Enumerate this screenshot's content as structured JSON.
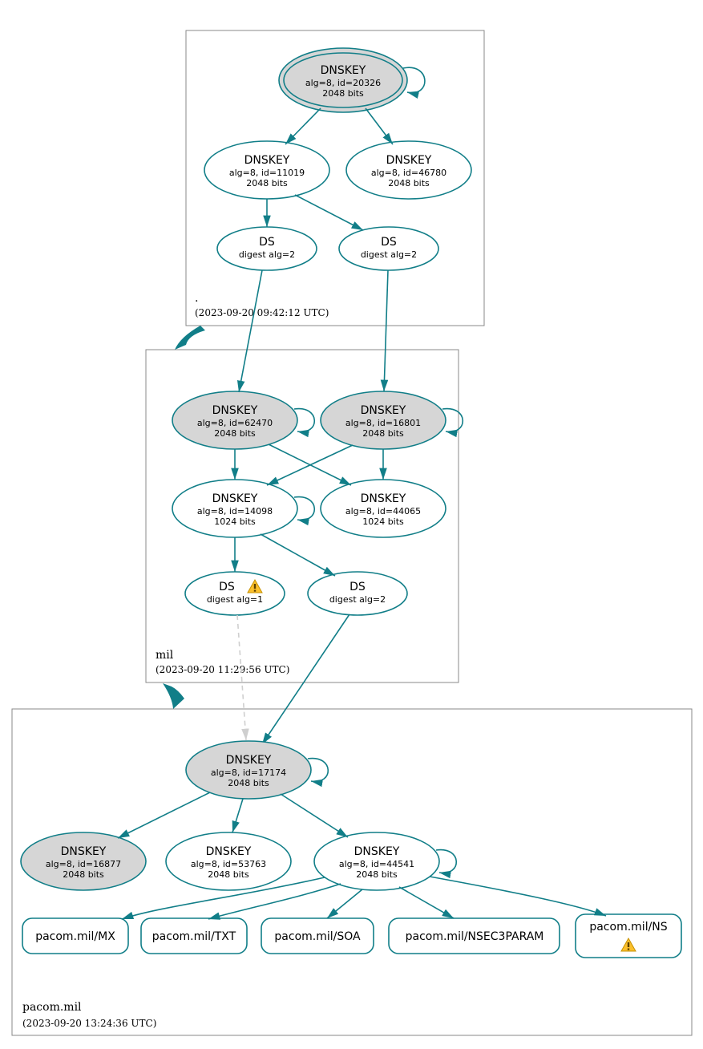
{
  "colors": {
    "teal": "#117e88",
    "grey_fill": "#d6d6d6",
    "warning_yellow": "#fbc02d",
    "warning_border": "#c79100",
    "warning_bang": "#5d4100"
  },
  "zones": {
    "root": {
      "title": ".",
      "timestamp": "(2023-09-20 09:42:12 UTC)"
    },
    "mil": {
      "title": "mil",
      "timestamp": "(2023-09-20 11:29:56 UTC)"
    },
    "pacom": {
      "title": "pacom.mil",
      "timestamp": "(2023-09-20 13:24:36 UTC)"
    }
  },
  "nodes": {
    "root_ksk": {
      "l1": "DNSKEY",
      "l2": "alg=8, id=20326",
      "l3": "2048 bits"
    },
    "root_zsk1": {
      "l1": "DNSKEY",
      "l2": "alg=8, id=11019",
      "l3": "2048 bits"
    },
    "root_zsk2": {
      "l1": "DNSKEY",
      "l2": "alg=8, id=46780",
      "l3": "2048 bits"
    },
    "root_ds1": {
      "l1": "DS",
      "l2": "digest alg=2"
    },
    "root_ds2": {
      "l1": "DS",
      "l2": "digest alg=2"
    },
    "mil_ksk1": {
      "l1": "DNSKEY",
      "l2": "alg=8, id=62470",
      "l3": "2048 bits"
    },
    "mil_ksk2": {
      "l1": "DNSKEY",
      "l2": "alg=8, id=16801",
      "l3": "2048 bits"
    },
    "mil_zsk1": {
      "l1": "DNSKEY",
      "l2": "alg=8, id=14098",
      "l3": "1024 bits"
    },
    "mil_zsk2": {
      "l1": "DNSKEY",
      "l2": "alg=8, id=44065",
      "l3": "1024 bits"
    },
    "mil_ds1": {
      "l1": "DS",
      "l2": "digest alg=1"
    },
    "mil_ds2": {
      "l1": "DS",
      "l2": "digest alg=2"
    },
    "pacom_ksk": {
      "l1": "DNSKEY",
      "l2": "alg=8, id=17174",
      "l3": "2048 bits"
    },
    "pacom_k1": {
      "l1": "DNSKEY",
      "l2": "alg=8, id=16877",
      "l3": "2048 bits"
    },
    "pacom_k2": {
      "l1": "DNSKEY",
      "l2": "alg=8, id=53763",
      "l3": "2048 bits"
    },
    "pacom_k3": {
      "l1": "DNSKEY",
      "l2": "alg=8, id=44541",
      "l3": "2048 bits"
    },
    "rr_mx": {
      "l1": "pacom.mil/MX"
    },
    "rr_txt": {
      "l1": "pacom.mil/TXT"
    },
    "rr_soa": {
      "l1": "pacom.mil/SOA"
    },
    "rr_nsec": {
      "l1": "pacom.mil/NSEC3PARAM"
    },
    "rr_ns": {
      "l1": "pacom.mil/NS"
    }
  }
}
